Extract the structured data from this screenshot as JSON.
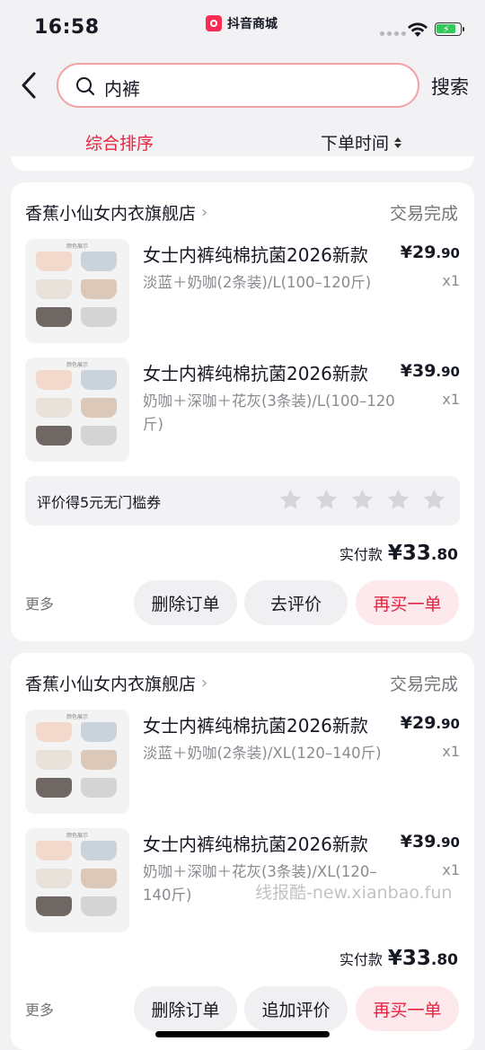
{
  "status_bar": {
    "time": "16:58",
    "app_name": "抖音商城"
  },
  "header": {
    "search_value": "内裤",
    "search_button": "搜索"
  },
  "sort": {
    "primary": "综合排序",
    "secondary": "下单时间"
  },
  "orders": [
    {
      "shop": "香蕉小仙女内衣旗舰店",
      "status": "交易完成",
      "items": [
        {
          "title": "女士内裤纯棉抗菌2026新款",
          "spec": "淡蓝＋奶咖(2条装)/L(100–120斤)",
          "price_int": "¥29",
          "price_dec": ".90",
          "qty": "x1"
        },
        {
          "title": "女士内裤纯棉抗菌2026新款",
          "spec": "奶咖＋深咖＋花灰(3条装)/L(100–120斤)",
          "price_int": "¥39",
          "price_dec": ".90",
          "qty": "x1"
        }
      ],
      "review_text": "评价得5元无门槛券",
      "pay_label": "实付款",
      "pay_int": "¥33",
      "pay_dec": ".80",
      "more": "更多",
      "buttons": [
        "删除订单",
        "去评价",
        "再买一单"
      ]
    },
    {
      "shop": "香蕉小仙女内衣旗舰店",
      "status": "交易完成",
      "items": [
        {
          "title": "女士内裤纯棉抗菌2026新款",
          "spec": "淡蓝＋奶咖(2条装)/XL(120–140斤)",
          "price_int": "¥29",
          "price_dec": ".90",
          "qty": "x1"
        },
        {
          "title": "女士内裤纯棉抗菌2026新款",
          "spec": "奶咖＋深咖＋花灰(3条装)/XL(120–140斤)",
          "price_int": "¥39",
          "price_dec": ".90",
          "qty": "x1"
        }
      ],
      "pay_label": "实付款",
      "pay_int": "¥33",
      "pay_dec": ".80",
      "more": "更多",
      "buttons": [
        "删除订单",
        "追加评价",
        "再买一单"
      ]
    }
  ],
  "thumb_header": "颜色展示",
  "watermark": "线报酷-new.xianbao.fun",
  "colors": {
    "accent_red": "#e4233f",
    "status_gray": "#74747a",
    "star_gray": "#d6d6da"
  }
}
